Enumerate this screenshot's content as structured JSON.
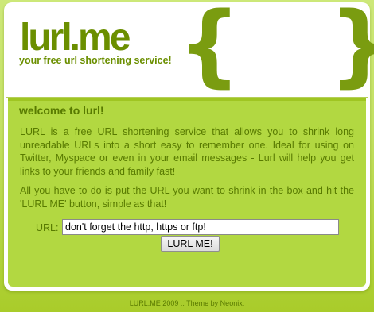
{
  "header": {
    "logo": "lurl.me",
    "tagline": "your free url shortening service!",
    "brace_left": "{",
    "brace_right": "}"
  },
  "content": {
    "title": "welcome to lurl!",
    "paragraph_1": "LURL is a free URL shortening service that allows you to shrink long unreadable URLs into a short easy to remember one. Ideal for using on Twitter, Myspace or even in your email messages - Lurl will help you get links to your friends and family fast!",
    "paragraph_2": "All you have to do is put the URL you want to shrink in the box and hit the 'LURL ME' button, simple as that!",
    "url_label": "URL:",
    "url_value": "don't forget the http, https or ftp!",
    "submit_label": "LURL ME!"
  },
  "footer": {
    "text": "LURL.ME 2009 :: Theme by Neonix."
  },
  "colors": {
    "brand_green": "#6b8f00",
    "panel_green": "#b2d841",
    "text_green": "#587a00",
    "background_green": "#c4e163"
  }
}
